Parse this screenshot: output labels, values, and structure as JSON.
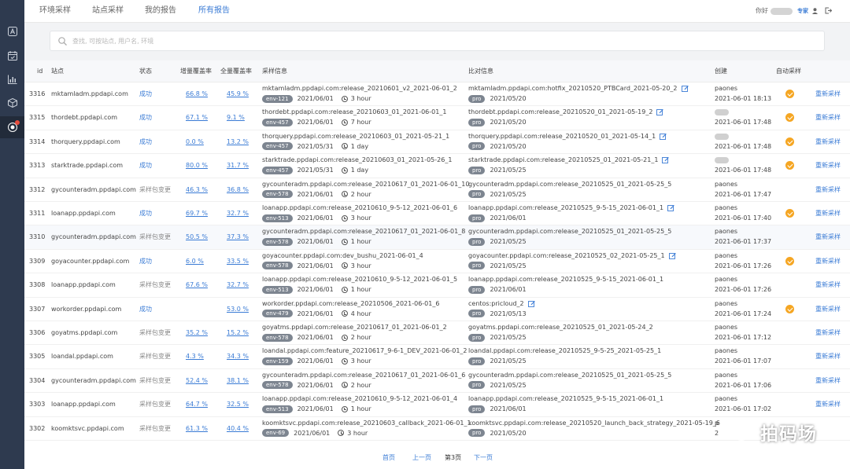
{
  "nav": {
    "tabs": [
      "环境采样",
      "站点采样",
      "我的报告",
      "所有报告"
    ],
    "active_tab": 3,
    "greeting": "你好",
    "pro_link": "专家"
  },
  "search": {
    "placeholder": "查找, 可按站点, 用户名, 环境"
  },
  "sidebar": {
    "icons": [
      "app-icon",
      "calendar-icon",
      "bar-chart-icon",
      "cube-icon",
      "record-icon"
    ],
    "active": 4
  },
  "table": {
    "headers": [
      "id",
      "站点",
      "状态",
      "增量覆盖率",
      "全量覆盖率",
      "采样信息",
      "比对信息",
      "创建",
      "自动采样"
    ],
    "rows": [
      {
        "id": "3316",
        "site": "mktamladm.ppdapi.com",
        "status": "成功",
        "inc": "66.8 %",
        "full": "45.9 %",
        "sample": "mktamladm.ppdapi.com:release_20210601_v2_2021-06-01_2",
        "env": "env-121",
        "sdate": "2021/06/01",
        "dur": "3 hour",
        "cmp": "mktamladm.ppdapi.com:hotfix_20210520_PTBCard_2021-05-20_2",
        "cenv": "pro",
        "cdate": "2021/05/20",
        "edit": true,
        "creator": "paones",
        "ctime": "2021-06-01 18:13",
        "auto": true,
        "action": "重新采样"
      },
      {
        "id": "3315",
        "site": "thordebt.ppdapi.com",
        "status": "成功",
        "inc": "67.1 %",
        "full": "9.1 %",
        "sample": "thordebt.ppdapi.com:release_20210603_01_2021-06-01_1",
        "env": "env-457",
        "sdate": "2021/06/01",
        "dur": "7 hour",
        "cmp": "thordebt.ppdapi.com:release_20210520_01_2021-05-19_2",
        "cenv": "pro",
        "cdate": "2021/05/20",
        "edit": true,
        "creator": "",
        "ctime": "2021-06-01 17:48",
        "auto": true,
        "action": "重新采样"
      },
      {
        "id": "3314",
        "site": "thorquery.ppdapi.com",
        "status": "成功",
        "inc": "0.0 %",
        "full": "13.2 %",
        "sample": "thorquery.ppdapi.com:release_20210603_01_2021-05-21_1",
        "env": "env-457",
        "sdate": "2021/05/31",
        "dur": "1 day",
        "cmp": "thorquery.ppdapi.com:release_20210520_01_2021-05-14_1",
        "cenv": "pro",
        "cdate": "2021/05/20",
        "edit": true,
        "creator": "",
        "ctime": "2021-06-01 17:48",
        "auto": true,
        "action": "重新采样"
      },
      {
        "id": "3313",
        "site": "starktrade.ppdapi.com",
        "status": "成功",
        "inc": "80.0 %",
        "full": "31.7 %",
        "sample": "starktrade.ppdapi.com:release_20210603_01_2021-05-26_1",
        "env": "env-457",
        "sdate": "2021/05/31",
        "dur": "1 day",
        "cmp": "starktrade.ppdapi.com:release_20210525_01_2021-05-21_1",
        "cenv": "pro",
        "cdate": "2021/05/25",
        "edit": true,
        "creator": "",
        "ctime": "2021-06-01 17:48",
        "auto": true,
        "action": "重新采样"
      },
      {
        "id": "3312",
        "site": "gycounteradm.ppdapi.com",
        "status": "采样包变更",
        "inc": "46.3 %",
        "full": "36.8 %",
        "sample": "gycounteradm.ppdapi.com:release_20210617_01_2021-06-01_10",
        "env": "env-578",
        "sdate": "2021/06/01",
        "dur": "2 hour",
        "cmp": "gycounteradm.ppdapi.com:release_20210525_01_2021-05-25_5",
        "cenv": "pro",
        "cdate": "2021/05/25",
        "edit": false,
        "creator": "paones",
        "ctime": "2021-06-01 17:47",
        "auto": false,
        "action": "重新采样"
      },
      {
        "id": "3311",
        "site": "loanapp.ppdapi.com",
        "status": "成功",
        "inc": "69.7 %",
        "full": "32.7 %",
        "sample": "loanapp.ppdapi.com:release_20210610_9-5-12_2021-06-01_6",
        "env": "env-513",
        "sdate": "2021/06/01",
        "dur": "3 hour",
        "cmp": "loanapp.ppdapi.com:release_20210525_9-5-15_2021-06-01_1",
        "cenv": "pro",
        "cdate": "2021/06/01",
        "edit": true,
        "creator": "paones",
        "ctime": "2021-06-01 17:40",
        "auto": true,
        "action": "重新采样"
      },
      {
        "id": "3310",
        "site": "gycounteradm.ppdapi.com",
        "status": "采样包变更",
        "inc": "50.5 %",
        "full": "37.3 %",
        "sample": "gycounteradm.ppdapi.com:release_20210617_01_2021-06-01_8",
        "env": "env-578",
        "sdate": "2021/06/01",
        "dur": "1 hour",
        "cmp": "gycounteradm.ppdapi.com:release_20210525_01_2021-05-25_5",
        "cenv": "pro",
        "cdate": "2021/05/25",
        "edit": false,
        "creator": "paones",
        "ctime": "2021-06-01 17:37",
        "auto": false,
        "action": "重新采样"
      },
      {
        "id": "3309",
        "site": "goyacounter.ppdapi.com",
        "status": "成功",
        "inc": "6.0 %",
        "full": "33.5 %",
        "sample": "goyacounter.ppdapi.com:dev_bushu_2021-06-01_4",
        "env": "env-578",
        "sdate": "2021/06/01",
        "dur": "3 hour",
        "cmp": "goyacounter.ppdapi.com:release_20210525_02_2021-05-25_1",
        "cenv": "pro",
        "cdate": "2021/05/25",
        "edit": true,
        "creator": "paones",
        "ctime": "2021-06-01 17:26",
        "auto": true,
        "action": "重新采样"
      },
      {
        "id": "3308",
        "site": "loanapp.ppdapi.com",
        "status": "采样包变更",
        "inc": "67.6 %",
        "full": "32.7 %",
        "sample": "loanapp.ppdapi.com:release_20210610_9-5-12_2021-06-01_5",
        "env": "env-513",
        "sdate": "2021/06/01",
        "dur": "1 hour",
        "cmp": "loanapp.ppdapi.com:release_20210525_9-5-15_2021-06-01_1",
        "cenv": "pro",
        "cdate": "2021/06/01",
        "edit": false,
        "creator": "paones",
        "ctime": "2021-06-01 17:26",
        "auto": false,
        "action": "重新采样"
      },
      {
        "id": "3307",
        "site": "workorder.ppdapi.com",
        "status": "成功",
        "inc": "",
        "full": "53.0 %",
        "sample": "workorder.ppdapi.com:release_20210506_2021-06-01_6",
        "env": "env-479",
        "sdate": "2021/06/01",
        "dur": "4 hour",
        "cmp": "centos:pricloud_2",
        "cenv": "pro",
        "cdate": "2021/05/13",
        "edit": true,
        "creator": "paones",
        "ctime": "2021-06-01 17:24",
        "auto": true,
        "action": "重新采样"
      },
      {
        "id": "3306",
        "site": "goyatms.ppdapi.com",
        "status": "采样包变更",
        "inc": "35.2 %",
        "full": "15.2 %",
        "sample": "goyatms.ppdapi.com:release_20210617_01_2021-06-01_2",
        "env": "env-578",
        "sdate": "2021/06/01",
        "dur": "2 hour",
        "cmp": "goyatms.ppdapi.com:release_20210525_01_2021-05-24_2",
        "cenv": "pro",
        "cdate": "2021/05/25",
        "edit": false,
        "creator": "paones",
        "ctime": "2021-06-01 17:12",
        "auto": false,
        "action": "重新采样"
      },
      {
        "id": "3305",
        "site": "loandal.ppdapi.com",
        "status": "采样包变更",
        "inc": "4.3 %",
        "full": "34.3 %",
        "sample": "loandal.ppdapi.com:feature_20210617_9-6-1_DEV_2021-06-01_2",
        "env": "env-159",
        "sdate": "2021/06/01",
        "dur": "3 hour",
        "cmp": "loandal.ppdapi.com:release_20210525_9-5-25_2021-05-25_1",
        "cenv": "pro",
        "cdate": "2021/05/25",
        "edit": false,
        "creator": "paones",
        "ctime": "2021-06-01 17:07",
        "auto": false,
        "action": "重新采样"
      },
      {
        "id": "3304",
        "site": "gycounteradm.ppdapi.com",
        "status": "采样包变更",
        "inc": "52.4 %",
        "full": "38.1 %",
        "sample": "gycounteradm.ppdapi.com:release_20210617_01_2021-06-01_6",
        "env": "env-578",
        "sdate": "2021/06/01",
        "dur": "2 hour",
        "cmp": "gycounteradm.ppdapi.com:release_20210525_01_2021-05-25_5",
        "cenv": "pro",
        "cdate": "2021/05/25",
        "edit": false,
        "creator": "paones",
        "ctime": "2021-06-01 17:06",
        "auto": false,
        "action": "重新采样"
      },
      {
        "id": "3303",
        "site": "loanapp.ppdapi.com",
        "status": "采样包变更",
        "inc": "64.7 %",
        "full": "32.5 %",
        "sample": "loanapp.ppdapi.com:release_20210610_9-5-12_2021-06-01_4",
        "env": "env-513",
        "sdate": "2021/06/01",
        "dur": "1 hour",
        "cmp": "loanapp.ppdapi.com:release_20210525_9-5-15_2021-06-01_1",
        "cenv": "pro",
        "cdate": "2021/06/01",
        "edit": false,
        "creator": "paones",
        "ctime": "2021-06-01 17:02",
        "auto": false,
        "action": "重新采样"
      },
      {
        "id": "3302",
        "site": "koomktsvc.ppdapi.com",
        "status": "采样包变更",
        "inc": "61.3 %",
        "full": "40.4 %",
        "sample": "koomktsvc.ppdapi.com:release_20210603_callback_2021-06-01_1",
        "env": "env-69",
        "sdate": "2021/06/01",
        "dur": "3 hour",
        "cmp": "koomktsvc.ppdapi.com:release_20210520_launch_back_strategy_2021-05-19_6",
        "cenv": "pro",
        "cdate": "2021/05/20",
        "edit": false,
        "creator": "p",
        "ctime": "2",
        "auto": false,
        "action": ""
      }
    ]
  },
  "pager": {
    "first": "首页",
    "prev": "上一页",
    "current": "第3页",
    "next": "下一页"
  },
  "watermark": {
    "text": "拍码场"
  },
  "colors": {
    "accent": "#3a7bd5",
    "sidebar": "#2e3a4f",
    "auto_check": "#f5a623",
    "env_badge": "#7d8590"
  }
}
